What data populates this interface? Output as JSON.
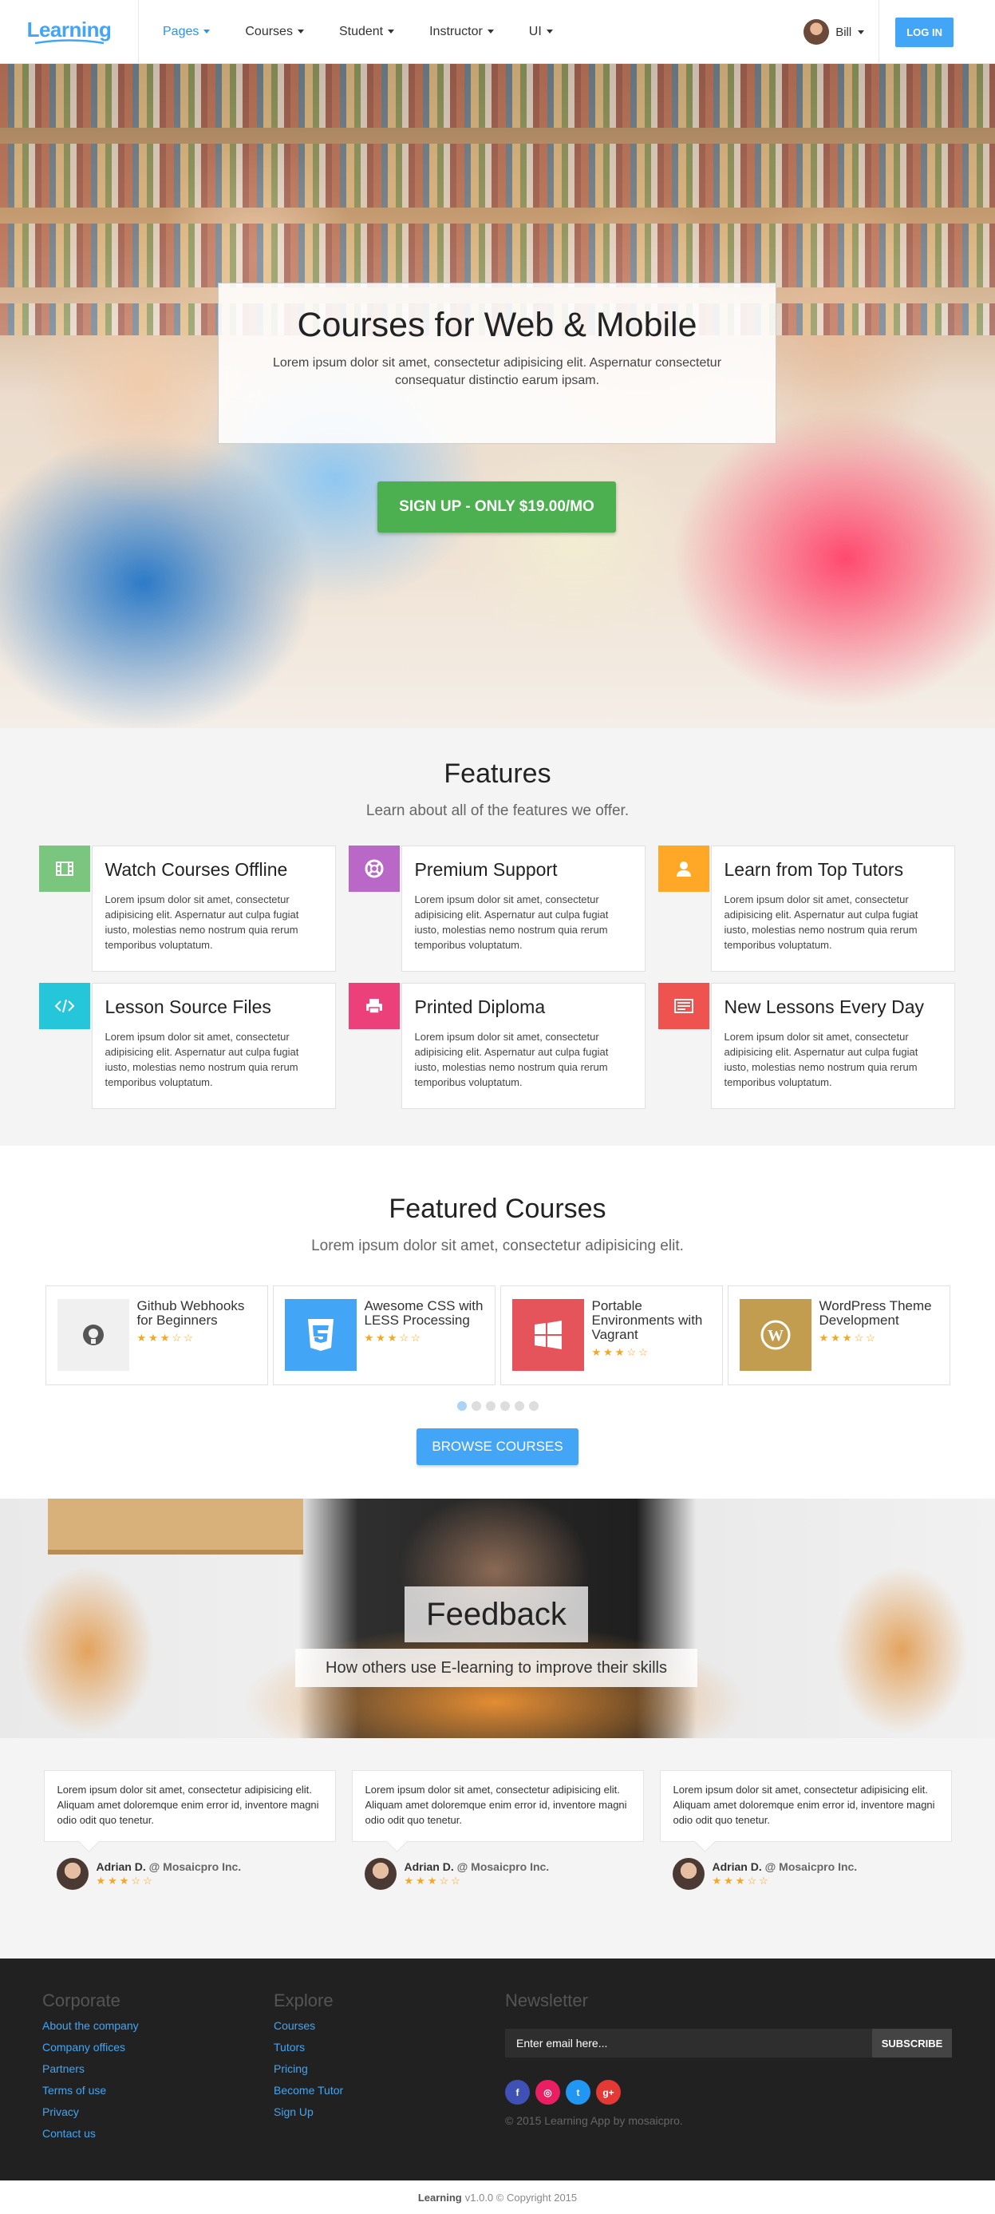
{
  "brand": {
    "name": "Learning"
  },
  "nav": {
    "items": [
      {
        "label": "Pages"
      },
      {
        "label": "Courses"
      },
      {
        "label": "Student"
      },
      {
        "label": "Instructor"
      },
      {
        "label": "UI"
      }
    ],
    "user_name": "Bill",
    "login_label": "LOG IN"
  },
  "hero": {
    "title": "Courses for Web & Mobile",
    "subtitle": "Lorem ipsum dolor sit amet, consectetur adipisicing elit. Aspernatur consectetur consequatur distinctio earum ipsam.",
    "cta": "SIGN UP - ONLY $19.00/MO"
  },
  "features": {
    "title": "Features",
    "subtitle": "Learn about all of the features we offer.",
    "items": [
      {
        "title": "Watch Courses Offline",
        "text": "Lorem ipsum dolor sit amet, consectetur adipisicing elit. Aspernatur aut culpa fugiat iusto, molestias nemo nostrum quia rerum temporibus voluptatum.",
        "color": "#7bc67e",
        "icon": "film-icon"
      },
      {
        "title": "Premium Support",
        "text": "Lorem ipsum dolor sit amet, consectetur adipisicing elit. Aspernatur aut culpa fugiat iusto, molestias nemo nostrum quia rerum temporibus voluptatum.",
        "color": "#ba68c8",
        "icon": "lifebuoy-icon"
      },
      {
        "title": "Learn from Top Tutors",
        "text": "Lorem ipsum dolor sit amet, consectetur adipisicing elit. Aspernatur aut culpa fugiat iusto, molestias nemo nostrum quia rerum temporibus voluptatum.",
        "color": "#ffa726",
        "icon": "user-icon"
      },
      {
        "title": "Lesson Source Files",
        "text": "Lorem ipsum dolor sit amet, consectetur adipisicing elit. Aspernatur aut culpa fugiat iusto, molestias nemo nostrum quia rerum temporibus voluptatum.",
        "color": "#26c6da",
        "icon": "code-icon"
      },
      {
        "title": "Printed Diploma",
        "text": "Lorem ipsum dolor sit amet, consectetur adipisicing elit. Aspernatur aut culpa fugiat iusto, molestias nemo nostrum quia rerum temporibus voluptatum.",
        "color": "#ec407a",
        "icon": "printer-icon"
      },
      {
        "title": "New Lessons Every Day",
        "text": "Lorem ipsum dolor sit amet, consectetur adipisicing elit. Aspernatur aut culpa fugiat iusto, molestias nemo nostrum quia rerum temporibus voluptatum.",
        "color": "#ef5350",
        "icon": "newspaper-icon"
      }
    ]
  },
  "featured_courses": {
    "title": "Featured Courses",
    "subtitle": "Lorem ipsum dolor sit amet, consectetur adipisicing elit.",
    "courses": [
      {
        "title": "Github Webhooks for Beginners",
        "rating": 3,
        "icon": "github-icon",
        "color": "#f0f0f0"
      },
      {
        "title": "Awesome CSS with LESS Processing",
        "rating": 3,
        "icon": "css3-icon",
        "color": "#42a5f5"
      },
      {
        "title": "Portable Environments with Vagrant",
        "rating": 3,
        "icon": "windows-icon",
        "color": "#e5545a"
      },
      {
        "title": "WordPress Theme Development",
        "rating": 3,
        "icon": "wordpress-icon",
        "color": "#c29d4f"
      }
    ],
    "pages": 6,
    "active_page": 1,
    "browse_label": "BROWSE COURSES"
  },
  "feedback": {
    "title": "Feedback",
    "subtitle": "How others use E-learning to improve their skills"
  },
  "testimonials": [
    {
      "text": "Lorem ipsum dolor sit amet, consectetur adipisicing elit. Aliquam amet doloremque enim error id, inventore magni odio odit quo tenetur.",
      "name": "Adrian D.",
      "company": "@ Mosaicpro Inc.",
      "rating": 3
    },
    {
      "text": "Lorem ipsum dolor sit amet, consectetur adipisicing elit. Aliquam amet doloremque enim error id, inventore magni odio odit quo tenetur.",
      "name": "Adrian D.",
      "company": "@ Mosaicpro Inc.",
      "rating": 3
    },
    {
      "text": "Lorem ipsum dolor sit amet, consectetur adipisicing elit. Aliquam amet doloremque enim error id, inventore magni odio odit quo tenetur.",
      "name": "Adrian D.",
      "company": "@ Mosaicpro Inc.",
      "rating": 3
    }
  ],
  "footer": {
    "corporate": {
      "title": "Corporate",
      "links": [
        "About the company",
        "Company offices",
        "Partners",
        "Terms of use",
        "Privacy",
        "Contact us"
      ]
    },
    "explore": {
      "title": "Explore",
      "links": [
        "Courses",
        "Tutors",
        "Pricing",
        "Become Tutor",
        "Sign Up"
      ]
    },
    "newsletter": {
      "title": "Newsletter",
      "input_placeholder": "Enter email here...",
      "button": "SUBSCRIBE",
      "socials": [
        {
          "icon": "facebook-icon",
          "glyph": "f",
          "color": "#3f51b5"
        },
        {
          "icon": "dribbble-icon",
          "glyph": "◎",
          "color": "#e91e63"
        },
        {
          "icon": "twitter-icon",
          "glyph": "t",
          "color": "#2196f3"
        },
        {
          "icon": "google-plus-icon",
          "glyph": "g+",
          "color": "#e53935"
        }
      ],
      "copyright": "© 2015 Learning App by mosaicpro."
    }
  },
  "bottom_bar": {
    "brand": "Learning",
    "rest": "v1.0.0 © Copyright 2015"
  },
  "colors": {
    "accent": "#42a5f5",
    "success": "#4caf50",
    "star": "#f5a623"
  }
}
